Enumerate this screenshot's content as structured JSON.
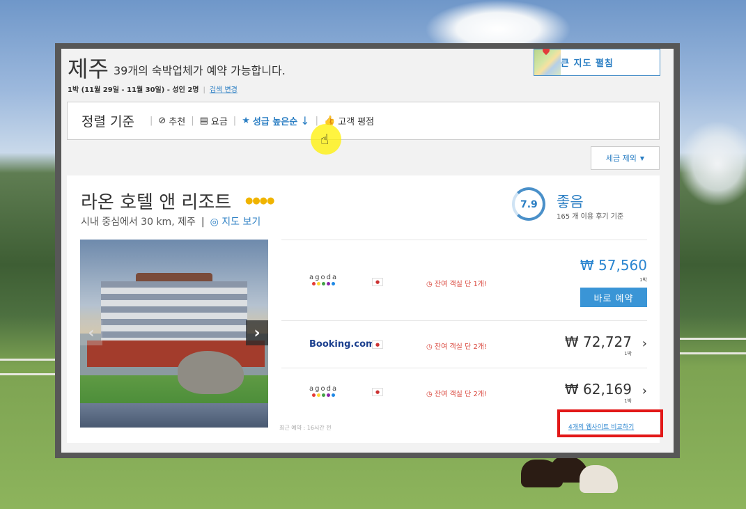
{
  "header": {
    "city": "제주",
    "count_text": "39개의 숙박업체가 예약 가능합니다.",
    "stay_info": "1박 (11월 29일 - 11월 30일) - 성인 2명",
    "change_search": "검색 변경",
    "map_button": "큰 지도 펼침"
  },
  "sort": {
    "title": "정렬 기준",
    "options": [
      {
        "label": "추천",
        "icon": "check-circle-icon"
      },
      {
        "label": "요금",
        "icon": "money-icon"
      },
      {
        "label": "성급 높은순",
        "icon": "star-icon",
        "active": true,
        "arrow": "↓"
      },
      {
        "label": "고객 평점",
        "icon": "thumbs-up-icon"
      }
    ]
  },
  "tax_button": "세금 제외",
  "hotel": {
    "name": "라온 호텔 앤 리조트",
    "stars": "●●●●",
    "location": "시내 중심에서 30 km, 제주",
    "map_link": "지도 보기",
    "score": "7.9",
    "score_word": "좋음",
    "reviews": "165 개 이용 후기 기준"
  },
  "offers": [
    {
      "vendor": "agoda",
      "availability": "잔여 객실 단 1개!",
      "price": "₩ 57,560",
      "per": "1박",
      "book": "바로 예약"
    },
    {
      "vendor": "Booking.com",
      "availability": "잔여 객실 단 2개!",
      "price": "₩ 72,727",
      "per": "1박"
    },
    {
      "vendor": "agoda",
      "availability": "잔여 객실 단 2개!",
      "price": "₩ 62,169",
      "per": "1박"
    }
  ],
  "recent": "최근 예약 : 16시간 전",
  "compare": "4개의 웹사이트 비교하기",
  "colors": {
    "accent": "#2a85d0",
    "highlight": "#e21818",
    "star": "#f0b400"
  }
}
